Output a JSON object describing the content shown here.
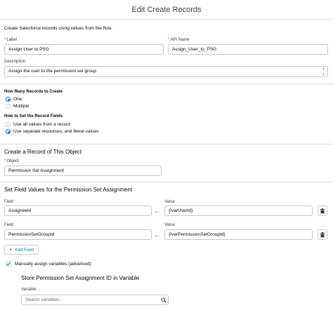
{
  "header": {
    "title": "Edit Create Records"
  },
  "intro": "Create Salesforce records using values from the flow.",
  "label_field": {
    "label": "Label",
    "value": "Assign User to PSG"
  },
  "api_name_field": {
    "label": "API Name",
    "value": "Assign_User_to_PSG"
  },
  "description_field": {
    "label": "Description",
    "value": "Assign the user to the permission set group"
  },
  "how_many": {
    "label": "How Many Records to Create",
    "options": [
      {
        "label": "One",
        "selected": true
      },
      {
        "label": "Multiple",
        "selected": false
      }
    ]
  },
  "how_to_set": {
    "label": "How to Set the Record Fields",
    "options": [
      {
        "label": "Use all values from a record",
        "selected": false
      },
      {
        "label": "Use separate resources, and literal values",
        "selected": true
      }
    ]
  },
  "create_section": {
    "heading": "Create a Record of This Object",
    "object_label": "Object",
    "object_value": "Permission Set Assignment"
  },
  "field_values": {
    "heading": "Set Field Values for the Permission Set Assignment",
    "field_label": "Field",
    "value_label": "Value",
    "rows": [
      {
        "field": "AssigneeId",
        "value": "{!varUserId}"
      },
      {
        "field": "PermissionSetGroupId",
        "value": "{!varPermissionSetGroupId}"
      }
    ],
    "add_field_label": "Add Field"
  },
  "manual_assign": {
    "label": "Manually assign variables (advanced)",
    "checked": true
  },
  "store": {
    "heading": "Store Permission Set Assignment ID in Variable",
    "variable_label": "Variable",
    "variable_placeholder": "Search variables..."
  },
  "colors": {
    "accent": "#0176d3",
    "border": "#c9c7c5",
    "required": "#c23934"
  },
  "icons": {
    "arrow": "left-arrow-icon",
    "trash": "trash-icon",
    "add": "plus-icon",
    "search": "search-icon",
    "check": "check-icon"
  }
}
